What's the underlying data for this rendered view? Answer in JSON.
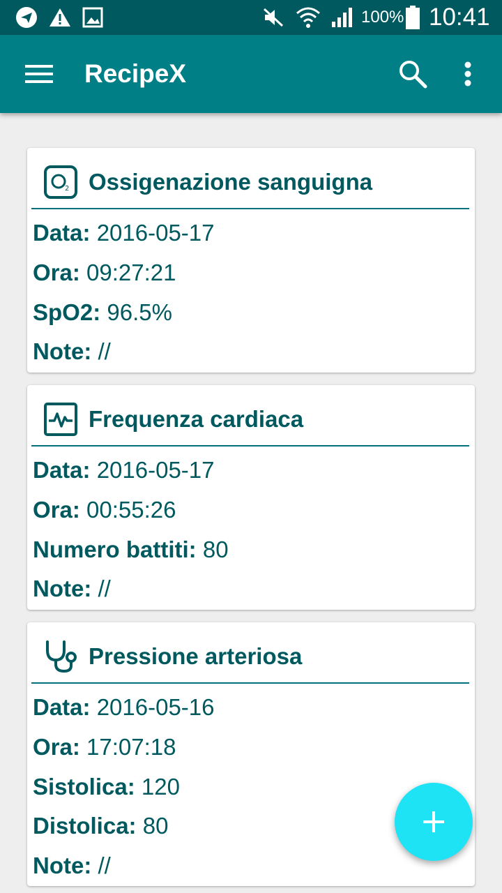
{
  "status_bar": {
    "battery": "100%",
    "time": "10:41",
    "icons": [
      "telegram-icon",
      "warning-icon",
      "image-icon",
      "mute-icon",
      "wifi-icon",
      "signal-icon",
      "battery-icon"
    ]
  },
  "app_bar": {
    "title": "RecipeX",
    "icons": [
      "menu-icon",
      "search-icon",
      "more-vert-icon"
    ]
  },
  "cards": [
    {
      "icon": "oxygen-icon",
      "title": "Ossigenazione sanguigna",
      "fields": [
        {
          "label": "Data:",
          "value": "2016-05-17"
        },
        {
          "label": "Ora:",
          "value": "09:27:21"
        },
        {
          "label": "SpO2:",
          "value": "96.5%"
        },
        {
          "label": "Note:",
          "value": "//"
        }
      ]
    },
    {
      "icon": "heart-rate-icon",
      "title": "Frequenza cardiaca",
      "fields": [
        {
          "label": "Data:",
          "value": "2016-05-17"
        },
        {
          "label": "Ora:",
          "value": "00:55:26"
        },
        {
          "label": "Numero battiti:",
          "value": "80"
        },
        {
          "label": "Note:",
          "value": "//"
        }
      ]
    },
    {
      "icon": "stethoscope-icon",
      "title": "Pressione arteriosa",
      "fields": [
        {
          "label": "Data:",
          "value": "2016-05-16"
        },
        {
          "label": "Ora:",
          "value": "17:07:18"
        },
        {
          "label": "Sistolica:",
          "value": "120"
        },
        {
          "label": "Distolica:",
          "value": "80"
        },
        {
          "label": "Note:",
          "value": "//"
        }
      ]
    }
  ],
  "fab": {
    "icon": "add-icon"
  },
  "colors": {
    "status_bar": "#00595e",
    "app_bar": "#007f87",
    "text_primary": "#00595e",
    "fab": "#1ee3f5",
    "background": "#eeeeee"
  }
}
